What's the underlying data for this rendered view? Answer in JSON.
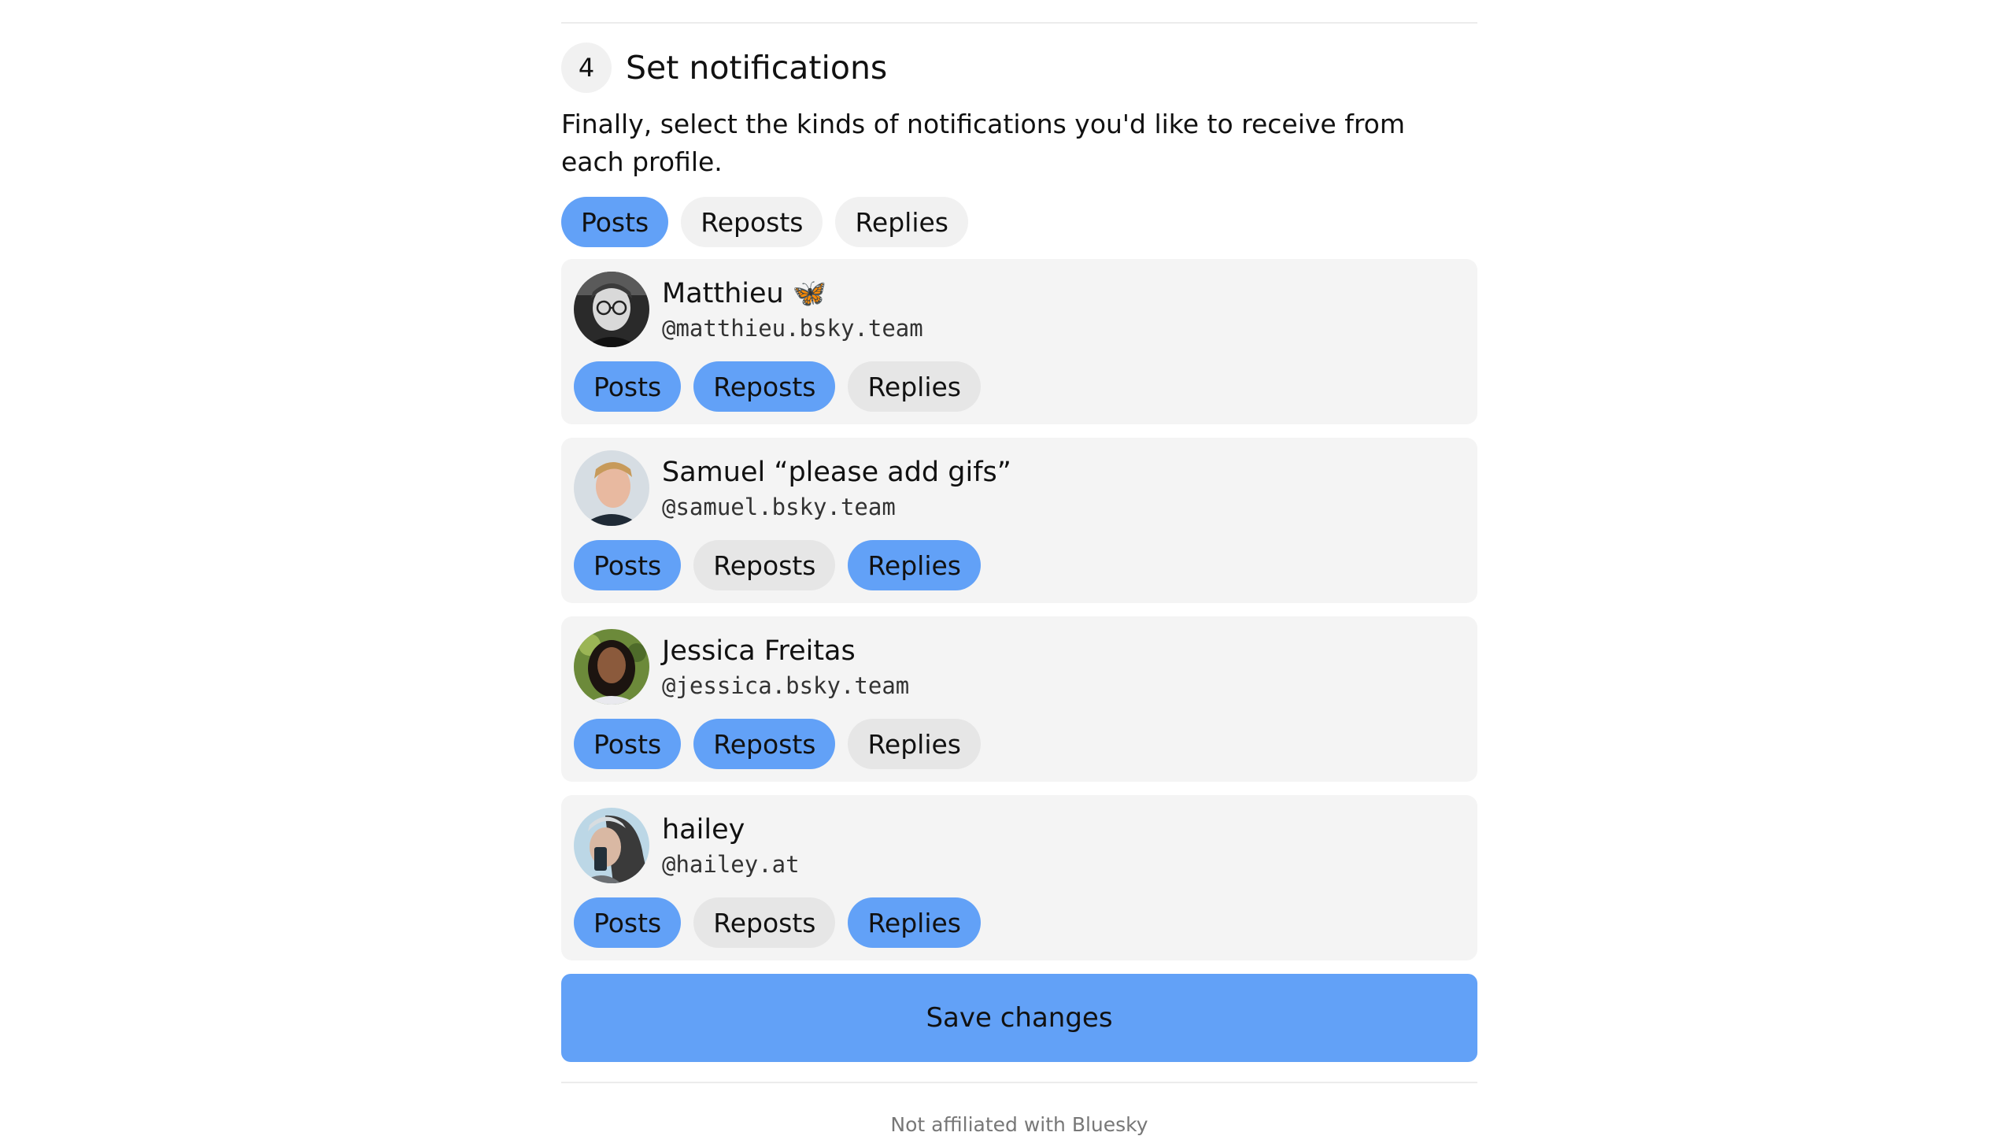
{
  "step": {
    "number": "4",
    "title": "Set notifications",
    "description": "Finally, select the kinds of notifications you'd like to receive from each profile."
  },
  "filters": [
    {
      "label": "Posts",
      "active": true
    },
    {
      "label": "Reposts",
      "active": false
    },
    {
      "label": "Replies",
      "active": false
    }
  ],
  "profiles": [
    {
      "name": "Matthieu 🦋",
      "handle": "@matthieu.bsky.team",
      "toggles": [
        {
          "label": "Posts",
          "active": true
        },
        {
          "label": "Reposts",
          "active": true
        },
        {
          "label": "Replies",
          "active": false
        }
      ]
    },
    {
      "name": "Samuel “please add gifs”",
      "handle": "@samuel.bsky.team",
      "toggles": [
        {
          "label": "Posts",
          "active": true
        },
        {
          "label": "Reposts",
          "active": false
        },
        {
          "label": "Replies",
          "active": true
        }
      ]
    },
    {
      "name": "Jessica Freitas",
      "handle": "@jessica.bsky.team",
      "toggles": [
        {
          "label": "Posts",
          "active": true
        },
        {
          "label": "Reposts",
          "active": true
        },
        {
          "label": "Replies",
          "active": false
        }
      ]
    },
    {
      "name": "hailey",
      "handle": "@hailey.at",
      "toggles": [
        {
          "label": "Posts",
          "active": true
        },
        {
          "label": "Reposts",
          "active": false
        },
        {
          "label": "Replies",
          "active": true
        }
      ]
    }
  ],
  "save_label": "Save changes",
  "footer_text": "Not affiliated with Bluesky",
  "colors": {
    "active_pill": "#62a1f7",
    "inactive_pill": "#f1f1f1",
    "card_background": "#f4f4f4",
    "save_button": "#62a1f7"
  }
}
